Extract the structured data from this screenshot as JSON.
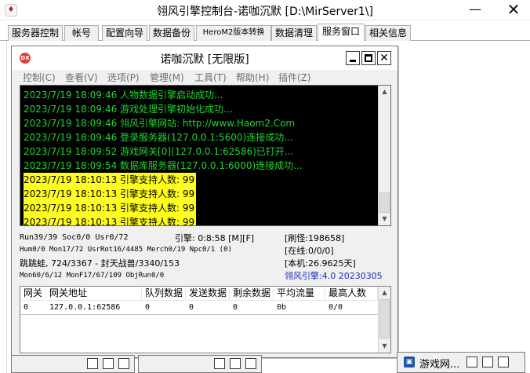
{
  "window": {
    "title": "翎风引擎控制台-诺咖沉默 [D:\\MirServer1\\]",
    "app_icon_glyph": "♦",
    "minimize_glyph": "—",
    "close_glyph": "✕"
  },
  "tabs": [
    {
      "label": "服务器控制",
      "active": false
    },
    {
      "label": "帐号",
      "active": false
    },
    {
      "label": "配置向导",
      "active": false
    },
    {
      "label": "数据备份",
      "active": false
    },
    {
      "label": "HeroM2版本转换",
      "active": false
    },
    {
      "label": "数据清理",
      "active": false
    },
    {
      "label": "服务窗口",
      "active": true
    },
    {
      "label": "相关信息",
      "active": false
    }
  ],
  "inner_window": {
    "title": "诺咖沉默 [无限版]",
    "icon_text": "DX",
    "close_glyph": "✕",
    "menu": [
      "控制(C)",
      "查看(V)",
      "选项(P)",
      "管理(M)",
      "工具(T)",
      "帮助(H)",
      "插件(Z)"
    ]
  },
  "log": [
    {
      "text": "2023/7/19 18:09:46 人物数据引擎启动成功...",
      "highlight": false
    },
    {
      "text": "2023/7/19 18:09:46 游戏处理引擎初始化成功...",
      "highlight": false
    },
    {
      "text": "2023/7/19 18:09:46 翎风引擎网站: http://www.Haom2.Com",
      "highlight": false
    },
    {
      "text": "2023/7/19 18:09:46 登录服务器(127.0.0.1:5600)连接成功...",
      "highlight": false
    },
    {
      "text": "2023/7/19 18:09:52 游戏网关[0](127.0.0.1:62586)已打开...",
      "highlight": false
    },
    {
      "text": "2023/7/19 18:09:54 数据库服务器(127.0.0.1:6000)连接成功...",
      "highlight": false
    },
    {
      "text": "2023/7/19 18:10:13 引擎支持人数: 99",
      "highlight": true
    },
    {
      "text": "2023/7/19 18:10:13 引擎支持人数: 99",
      "highlight": true
    },
    {
      "text": "2023/7/19 18:10:13 引擎支持人数: 99",
      "highlight": true
    },
    {
      "text": "2023/7/19 18:10:13 引擎支持人数: 99",
      "highlight": true
    }
  ],
  "status": {
    "r1_left": "Run39/39 Soc0/0 Usr0/72",
    "r1_mid": "引擎: 0:8:58 [M][F]",
    "r1_right": "[刷怪:198658]",
    "r2_left": "Hum0/0 Mon17/72 UsrRot16/4485 Merch0/19 Npc0/1 (0)",
    "r2_right": "[在线:0/0/0]",
    "r3_left": "跳跳蛙, 724/3367 - 封天战兽/3340/153",
    "r3_right": "[本机:26.9625天]",
    "r4_left": "Mon60/6/12 MonF17/67/109 ObjRun0/0",
    "r4_right": "翎风引擎:4.0 20230305"
  },
  "gateway_table": {
    "headers": [
      "网关",
      "网关地址",
      "队列数据",
      "发送数据",
      "剩余数据",
      "平均流量",
      "最高人数"
    ],
    "rows": [
      [
        "0",
        "127.0.0.1:62586",
        "0",
        "0",
        "0",
        "0b",
        "0/0"
      ]
    ]
  },
  "minimized": {
    "gateway_label": "游戏网...",
    "gateway_icon": "▣"
  }
}
